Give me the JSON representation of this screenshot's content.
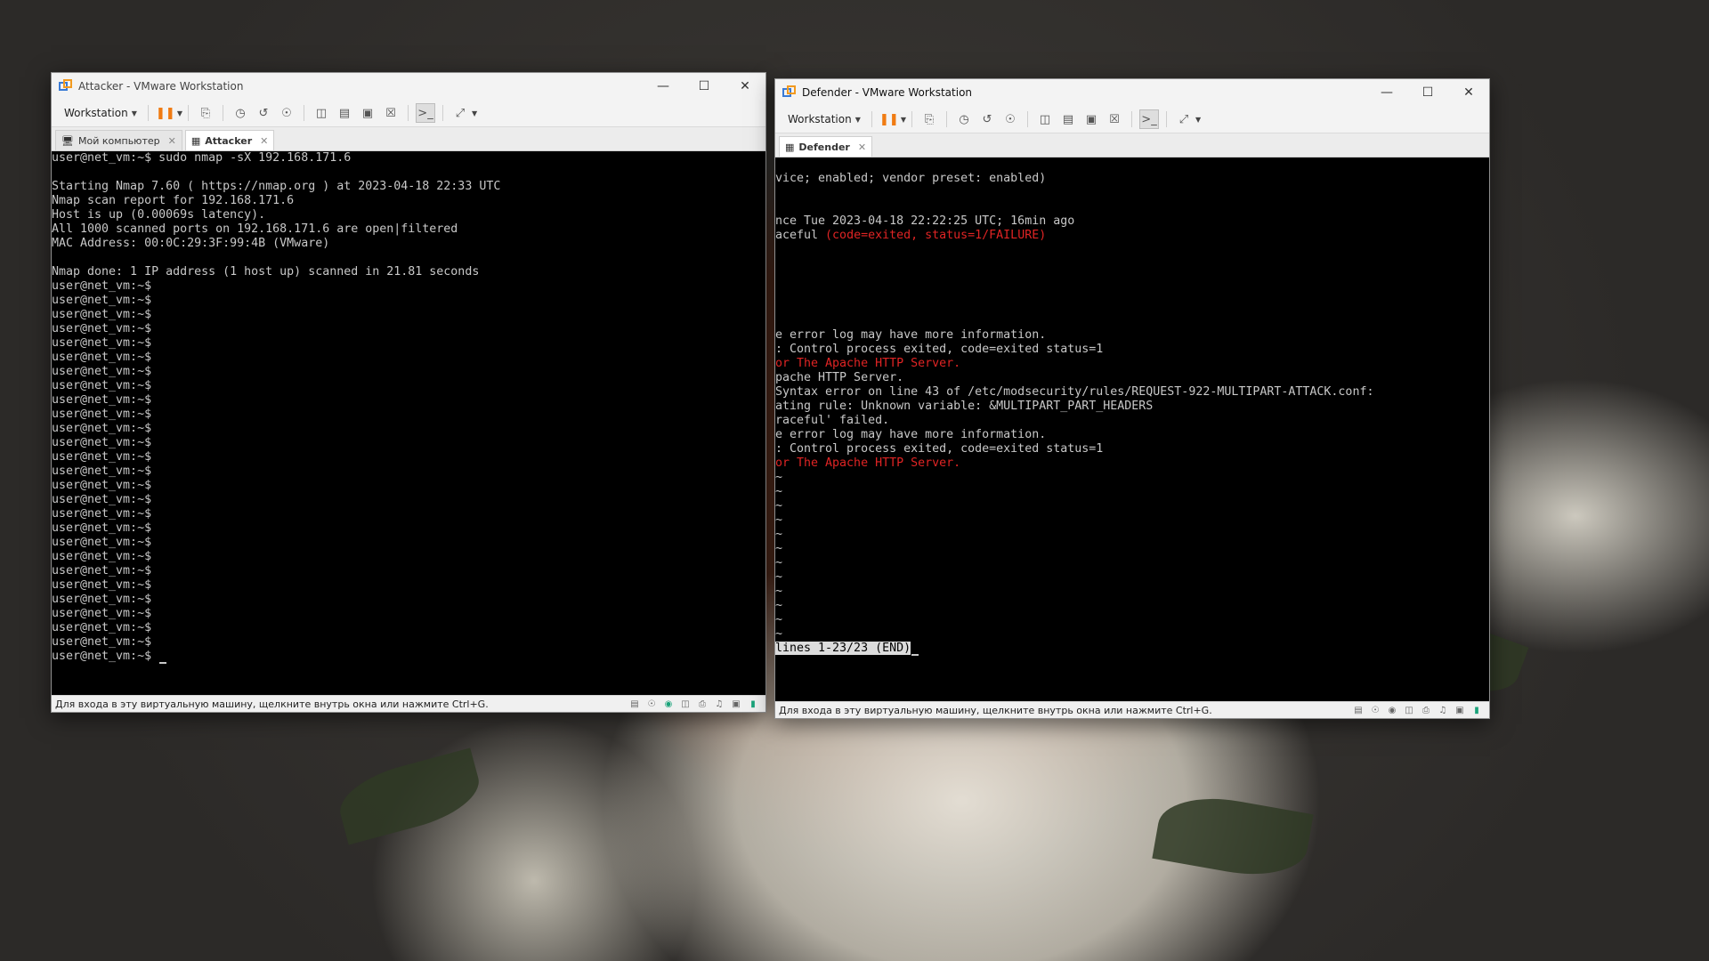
{
  "colors": {
    "terminal_bg": "#000000",
    "terminal_fg": "#c8c8c8",
    "error_red": "#e02424",
    "pause_orange": "#f07b12"
  },
  "attacker": {
    "title": "Attacker - VMware Workstation",
    "toolbar": {
      "menu_label": "Workstation"
    },
    "tabs": [
      {
        "label": "Мой компьютер"
      },
      {
        "label": "Attacker"
      }
    ],
    "terminal": {
      "lines": [
        "user@net_vm:~$ sudo nmap -sX 192.168.171.6",
        "",
        "Starting Nmap 7.60 ( https://nmap.org ) at 2023-04-18 22:33 UTC",
        "Nmap scan report for 192.168.171.6",
        "Host is up (0.00069s latency).",
        "All 1000 scanned ports on 192.168.171.6 are open|filtered",
        "MAC Address: 00:0C:29:3F:99:4B (VMware)",
        "",
        "Nmap done: 1 IP address (1 host up) scanned in 21.81 seconds",
        "user@net_vm:~$",
        "user@net_vm:~$",
        "user@net_vm:~$",
        "user@net_vm:~$",
        "user@net_vm:~$",
        "user@net_vm:~$",
        "user@net_vm:~$",
        "user@net_vm:~$",
        "user@net_vm:~$",
        "user@net_vm:~$",
        "user@net_vm:~$",
        "user@net_vm:~$",
        "user@net_vm:~$",
        "user@net_vm:~$",
        "user@net_vm:~$",
        "user@net_vm:~$",
        "user@net_vm:~$",
        "user@net_vm:~$",
        "user@net_vm:~$",
        "user@net_vm:~$",
        "user@net_vm:~$",
        "user@net_vm:~$",
        "user@net_vm:~$",
        "user@net_vm:~$",
        "user@net_vm:~$",
        "user@net_vm:~$"
      ],
      "prompt": "user@net_vm:~$ "
    },
    "status_text": "Для входа в эту виртуальную машину, щелкните внутрь окна или нажмите Ctrl+G."
  },
  "defender": {
    "title": "Defender - VMware Workstation",
    "toolbar": {
      "menu_label": "Workstation"
    },
    "tabs": [
      {
        "label": "Defender"
      }
    ],
    "terminal": {
      "lines": [
        {
          "text": ""
        },
        {
          "text": "vice; enabled; vendor preset: enabled)"
        },
        {
          "text": ""
        },
        {
          "text": ""
        },
        {
          "text": "nce Tue 2023-04-18 22:22:25 UTC; 16min ago"
        },
        {
          "text": "aceful ",
          "red": "(code=exited, status=1/FAILURE)"
        },
        {
          "text": ""
        },
        {
          "text": ""
        },
        {
          "text": ""
        },
        {
          "text": ""
        },
        {
          "text": ""
        },
        {
          "text": ""
        },
        {
          "text": "e error log may have more information."
        },
        {
          "text": ": Control process exited, code=exited status=1"
        },
        {
          "text": "",
          "red": "or The Apache HTTP Server."
        },
        {
          "text": "pache HTTP Server."
        },
        {
          "text": "Syntax error on line 43 of /etc/modsecurity/rules/REQUEST-922-MULTIPART-ATTACK.conf:"
        },
        {
          "text": "ating rule: Unknown variable: &MULTIPART_PART_HEADERS"
        },
        {
          "text": "raceful' failed."
        },
        {
          "text": "e error log may have more information."
        },
        {
          "text": ": Control process exited, code=exited status=1"
        },
        {
          "text": "",
          "red": "or The Apache HTTP Server."
        },
        {
          "text": "~"
        },
        {
          "text": "~"
        },
        {
          "text": "~"
        },
        {
          "text": "~"
        },
        {
          "text": "~"
        },
        {
          "text": "~"
        },
        {
          "text": "~"
        },
        {
          "text": "~"
        },
        {
          "text": "~"
        },
        {
          "text": "~"
        },
        {
          "text": "~"
        },
        {
          "text": "~"
        }
      ],
      "pager_status": "lines 1-23/23 (END)"
    },
    "status_text": "Для входа в эту виртуальную машину, щелкните внутрь окна или нажмите Ctrl+G."
  },
  "icons": {
    "toolbar": [
      "pause-icon",
      "send-keys-icon",
      "snapshot-icon",
      "revert-snapshot-icon",
      "snapshot-manager-icon",
      "library-icon",
      "thumbnail-bar-icon",
      "fullscreen-icon",
      "unity-icon",
      "console-view-icon",
      "stretch-icon"
    ],
    "status": [
      "hdd-icon",
      "cd-icon",
      "network-icon",
      "usb-icon",
      "printer-icon",
      "sound-icon",
      "display-icon",
      "message-icon"
    ]
  }
}
